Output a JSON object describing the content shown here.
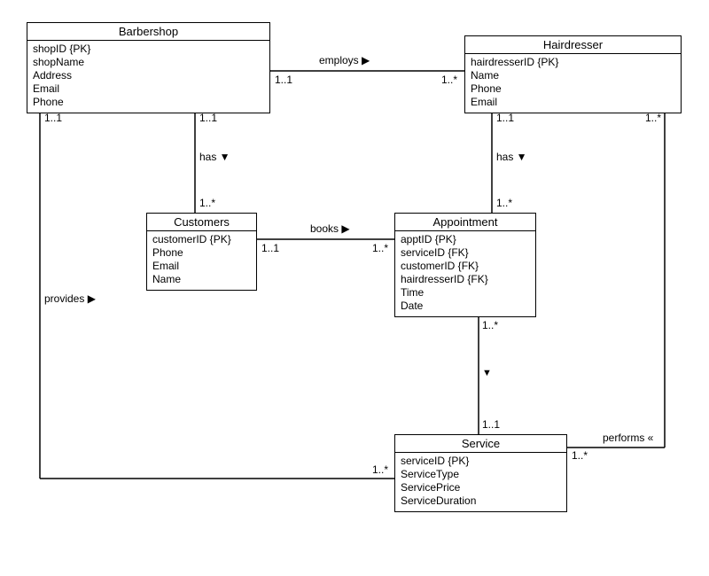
{
  "entities": {
    "barbershop": {
      "title": "Barbershop",
      "attrs": [
        "shopID {PK}",
        "shopName",
        "Address",
        "Email",
        "Phone"
      ]
    },
    "hairdresser": {
      "title": "Hairdresser",
      "attrs": [
        "hairdresserID {PK}",
        "Name",
        "Phone",
        "Email"
      ]
    },
    "customers": {
      "title": "Customers",
      "attrs": [
        "customerID {PK}",
        "Phone",
        "Email",
        "Name"
      ]
    },
    "appointment": {
      "title": "Appointment",
      "attrs": [
        "apptID {PK}",
        "serviceID {FK}",
        "customerID {FK}",
        "hairdresserID {FK}",
        "Time",
        "Date"
      ]
    },
    "service": {
      "title": "Service",
      "attrs": [
        "serviceID {PK}",
        "ServiceType",
        "ServicePrice",
        "ServiceDuration"
      ]
    }
  },
  "relations": {
    "employs": {
      "label": "employs ▶",
      "m1": "1..1",
      "m2": "1..*"
    },
    "bs_has_cust": {
      "label": "has ▼",
      "m1": "1..1",
      "m2": "1..*"
    },
    "books": {
      "label": "books ▶",
      "m1": "1..1",
      "m2": "1..*"
    },
    "hd_has_appt": {
      "label": "has ▼",
      "m1": "1..1",
      "m2": "1..*"
    },
    "appt_service": {
      "label": "▼",
      "m1": "1..*",
      "m2": "1..1"
    },
    "provides": {
      "label": "provides ▶",
      "m1": "1..1",
      "m2": "1..*"
    },
    "performs": {
      "label": "performs «",
      "m1": "1..*",
      "m2": "1..*"
    }
  }
}
